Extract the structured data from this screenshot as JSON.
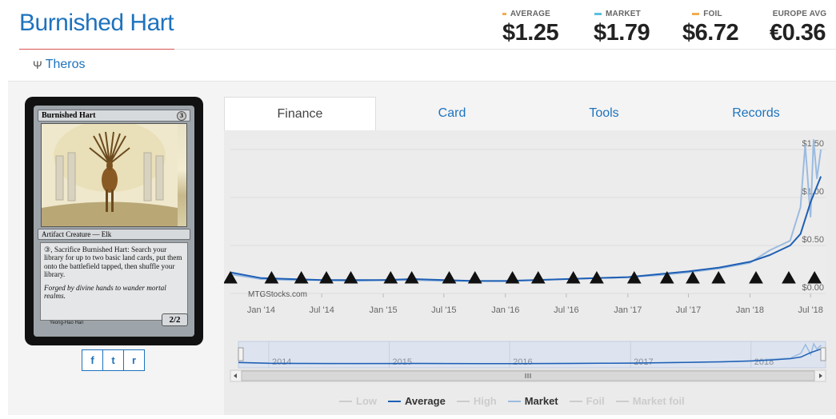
{
  "card": {
    "title": "Burnished Hart",
    "set_name": "Theros",
    "set_icon": "theros-set-icon",
    "image": {
      "name": "Burnished Hart",
      "cost": "3",
      "type_line": "Artifact Creature — Elk",
      "rules_text": "③, Sacrifice Burnished Hart: Search your library for up to two basic land cards, put them onto the battlefield tapped, then shuffle your library.",
      "flavor_text": "Forged by divine hands to wander mortal realms.",
      "power_toughness": "2/2",
      "artist": "Yeong-Hao Han"
    }
  },
  "prices": [
    {
      "label": "AVERAGE",
      "value": "$1.25",
      "color": "#f0ad4e"
    },
    {
      "label": "MARKET",
      "value": "$1.79",
      "color": "#5bc0de"
    },
    {
      "label": "FOIL",
      "value": "$6.72",
      "color": "#f0ad4e"
    },
    {
      "label": "EUROPE AVG",
      "value": "€0.36",
      "color": "#777777"
    }
  ],
  "share": {
    "facebook": "f",
    "twitter": "t",
    "reddit": "r"
  },
  "tabs": [
    "Finance",
    "Card",
    "Tools",
    "Records"
  ],
  "active_tab": "Finance",
  "chart_data": {
    "type": "line",
    "watermark": "MTGStocks.com",
    "x_ticks": [
      "Jan '14",
      "Jul '14",
      "Jan '15",
      "Jul '15",
      "Jan '16",
      "Jul '16",
      "Jan '17",
      "Jul '17",
      "Jan '18",
      "Jul '18"
    ],
    "y_ticks": [
      "$0.00",
      "$0.50",
      "$1.00",
      "$1.50"
    ],
    "ylim": [
      0,
      1.6
    ],
    "series": [
      {
        "name": "Average",
        "color": "#1e5fb4",
        "x": [
          "2013-10",
          "2014-01",
          "2014-04",
          "2014-07",
          "2014-10",
          "2015-01",
          "2015-04",
          "2015-07",
          "2015-10",
          "2016-01",
          "2016-04",
          "2016-07",
          "2016-10",
          "2017-01",
          "2017-04",
          "2017-07",
          "2017-10",
          "2018-01",
          "2018-03",
          "2018-05",
          "2018-06",
          "2018-07",
          "2018-08"
        ],
        "values": [
          0.22,
          0.16,
          0.15,
          0.14,
          0.14,
          0.14,
          0.15,
          0.14,
          0.13,
          0.13,
          0.14,
          0.15,
          0.16,
          0.17,
          0.2,
          0.23,
          0.27,
          0.33,
          0.4,
          0.5,
          0.62,
          0.95,
          1.22
        ]
      },
      {
        "name": "Market",
        "color": "#9bbbe0",
        "x": [
          "2013-10",
          "2014-01",
          "2014-04",
          "2014-07",
          "2014-10",
          "2015-01",
          "2015-04",
          "2015-07",
          "2015-10",
          "2016-01",
          "2016-04",
          "2016-07",
          "2016-10",
          "2017-01",
          "2017-04",
          "2017-07",
          "2017-10",
          "2018-01",
          "2018-03",
          "2018-05",
          "2018-06",
          "2018-06-15",
          "2018-07",
          "2018-07-10",
          "2018-07-20",
          "2018-08"
        ],
        "values": [
          0.2,
          0.15,
          0.14,
          0.14,
          0.13,
          0.14,
          0.14,
          0.13,
          0.13,
          0.13,
          0.14,
          0.15,
          0.16,
          0.17,
          0.19,
          0.22,
          0.26,
          0.32,
          0.45,
          0.55,
          0.9,
          1.55,
          0.8,
          1.6,
          1.2,
          1.5
        ]
      }
    ],
    "legend": [
      {
        "name": "Low",
        "color": "#cccccc",
        "active": false
      },
      {
        "name": "Average",
        "color": "#1e5fb4",
        "active": true
      },
      {
        "name": "High",
        "color": "#cccccc",
        "active": false
      },
      {
        "name": "Market",
        "color": "#9bbbe0",
        "active": true
      },
      {
        "name": "Foil",
        "color": "#cccccc",
        "active": false
      },
      {
        "name": "Market foil",
        "color": "#cccccc",
        "active": false
      }
    ],
    "navigator_ticks": [
      "2014",
      "2015",
      "2016",
      "2017",
      "2018"
    ],
    "set_symbols": [
      "ths",
      "bng",
      "jou",
      "m15",
      "ktk",
      "frf",
      "dtk",
      "ori",
      "bfz",
      "ogw",
      "soi",
      "emn",
      "kld",
      "aer",
      "akh",
      "hou",
      "xln",
      "rix",
      "dom",
      "m19"
    ]
  }
}
